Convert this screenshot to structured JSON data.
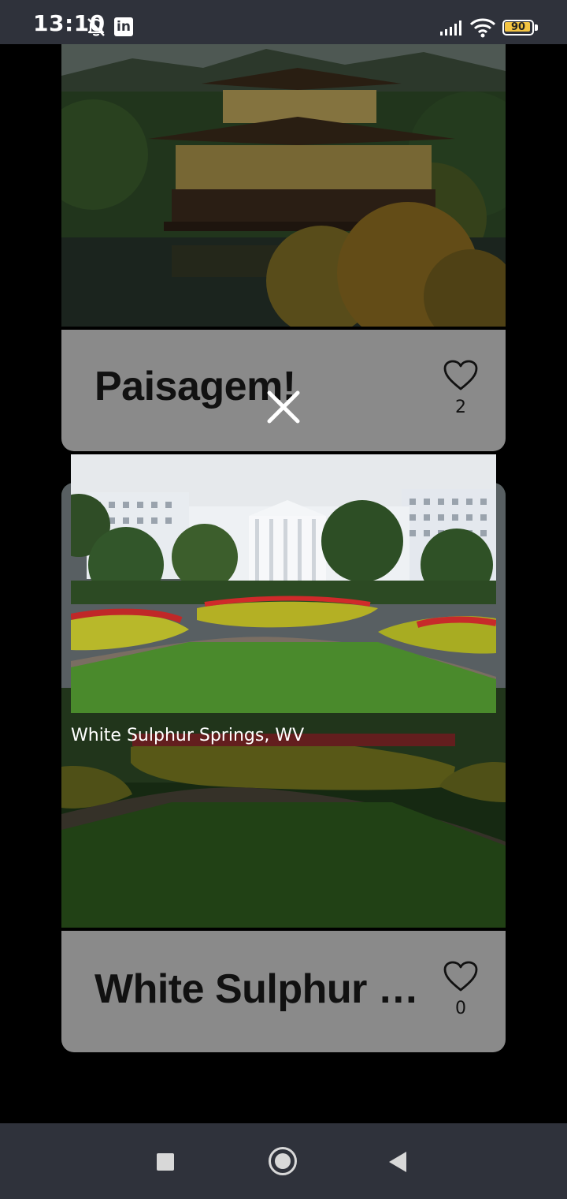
{
  "status_bar": {
    "time": "13:10",
    "battery_level": "90",
    "icons": [
      "bell-off-icon",
      "linkedin-icon",
      "signal-icon",
      "wifi-icon",
      "battery-icon"
    ],
    "linkedin_label": "in"
  },
  "cards": [
    {
      "title": "Paisagem!",
      "likes": "2"
    },
    {
      "title": "White Sulphur S...",
      "likes": "0"
    }
  ],
  "preview": {
    "caption": "White Sulphur Springs, WV"
  },
  "nav": {
    "icons": [
      "recents-button",
      "home-button",
      "back-button"
    ]
  },
  "colors": {
    "status_bar_bg": "#2f323b",
    "card_footer_bg": "#8a8a8a",
    "battery_fill": "#f5c542"
  }
}
